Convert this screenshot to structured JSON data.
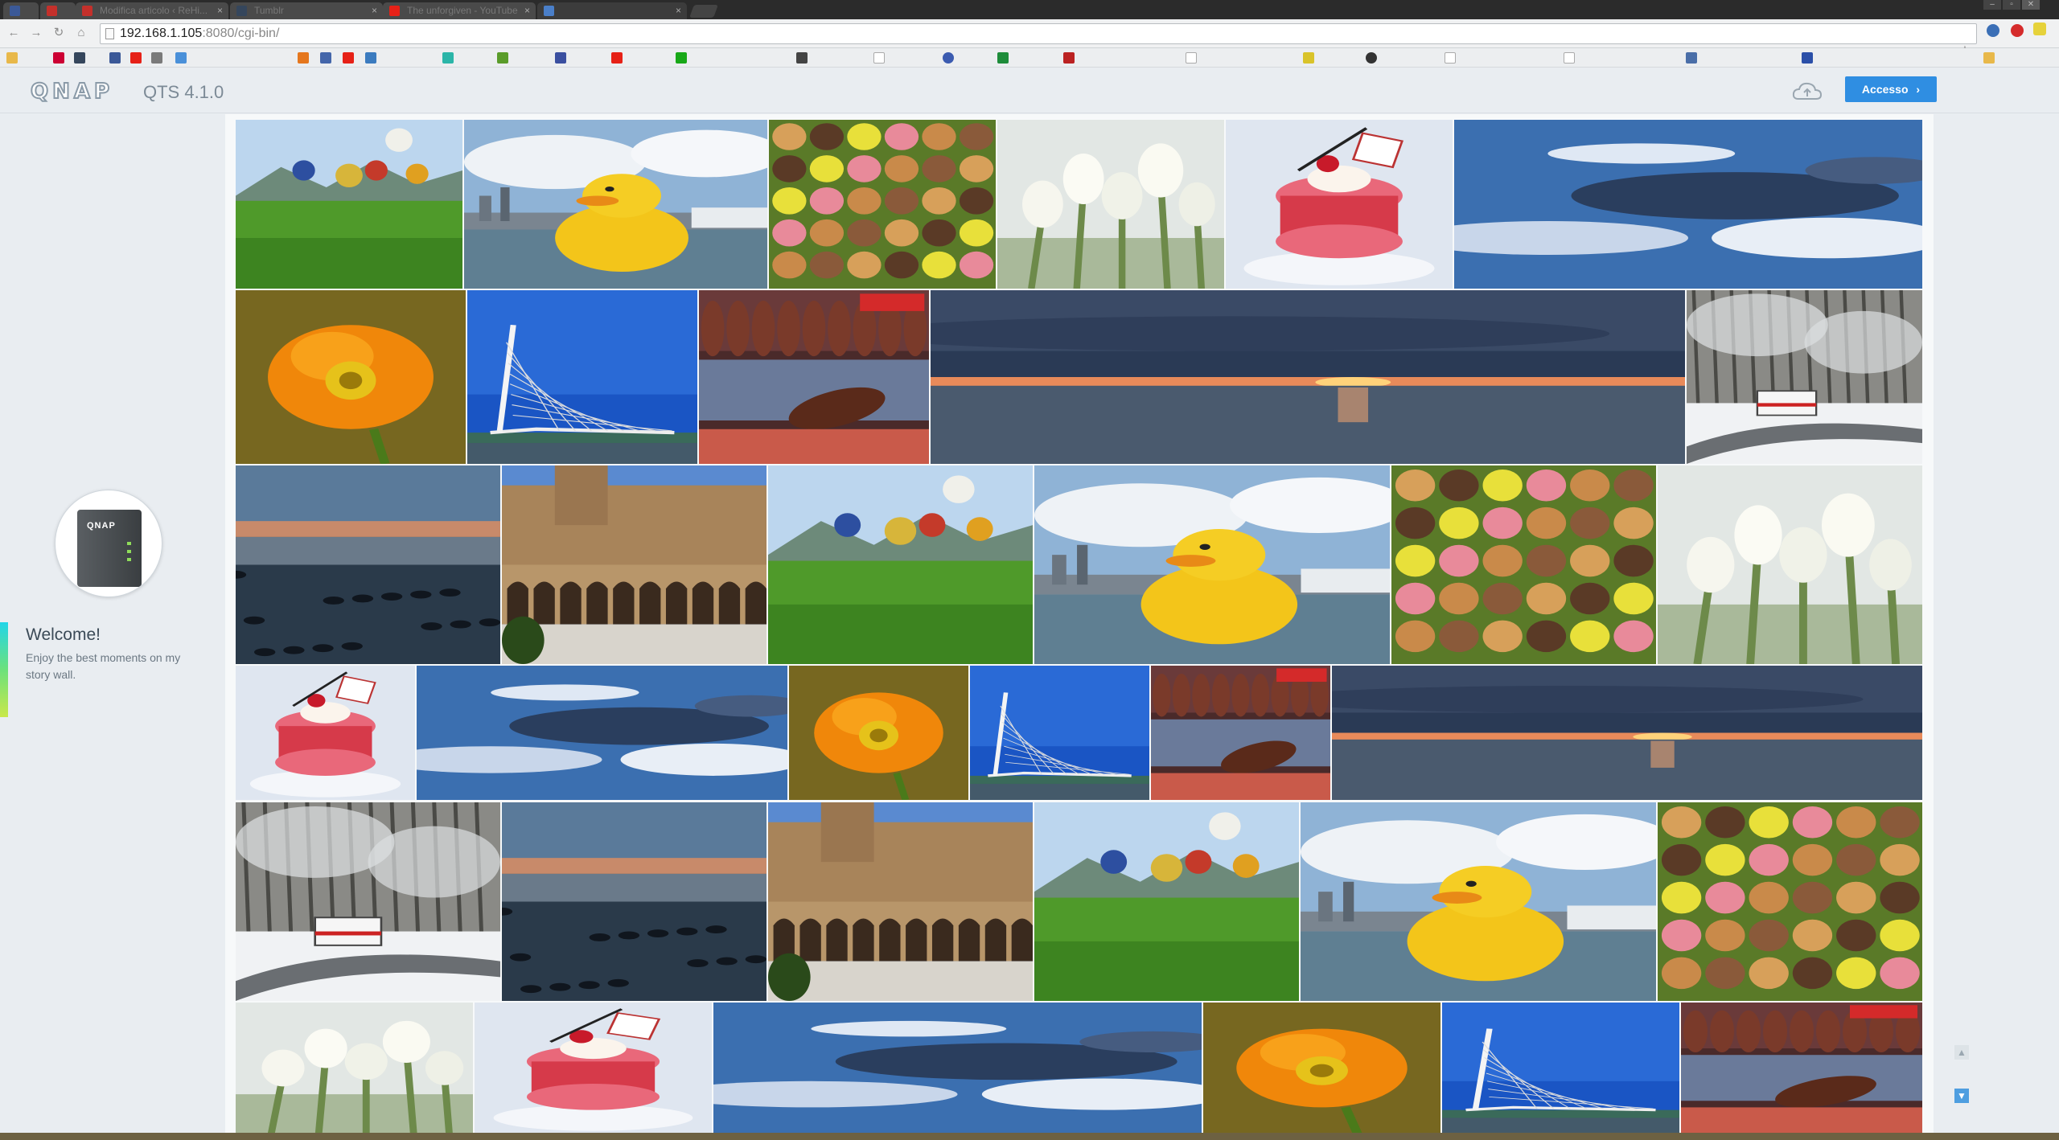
{
  "browser": {
    "tabs": [
      {
        "title": "",
        "favicon": "facebook-icon",
        "color": "#3b5998"
      },
      {
        "title": "",
        "favicon": "red-icon",
        "color": "#c4302b"
      },
      {
        "title": "Modifica articolo ‹ ReHi...",
        "favicon": "wordpress-icon",
        "color": "#c4302b"
      },
      {
        "title": "Tumblr",
        "favicon": "tumblr-icon",
        "color": "#35465c"
      },
      {
        "title": "The unforgiven - YouTube",
        "favicon": "youtube-icon",
        "color": "#e62117"
      },
      {
        "title": "",
        "favicon": "qnap-icon",
        "color": "#4a7fc9"
      }
    ],
    "url_host": "192.168.1.105",
    "url_port": ":8080",
    "url_path": "/cgi-bin/"
  },
  "header": {
    "logo_text": "QNAP",
    "version": "QTS 4.1.0",
    "login_label": "Accesso",
    "login_arrow": "›"
  },
  "sidebar": {
    "device_brand": "QNAP",
    "welcome_title": "Welcome!",
    "welcome_text": "Enjoy the best moments on my story wall."
  },
  "colors": {
    "accent": "#2f8ee2",
    "wall_background": "#f7f9fa",
    "sidebar_background": "#e9edf1"
  },
  "photos": [
    "balloons",
    "duck",
    "macarons",
    "tulips",
    "macaron-dessert",
    "sky",
    "poppy",
    "bridge",
    "ham-shop",
    "sunset-sea",
    "snow-bus",
    "dusk-lake",
    "alhambra",
    "balloons",
    "duck",
    "macarons",
    "tulips",
    "macaron-dessert",
    "sky",
    "poppy",
    "bridge",
    "ham-shop",
    "sunset-sea",
    "snow-bus",
    "dusk-lake",
    "alhambra",
    "balloons",
    "duck",
    "macarons",
    "tulips",
    "macaron-dessert",
    "sky",
    "poppy",
    "bridge",
    "ham-shop"
  ]
}
